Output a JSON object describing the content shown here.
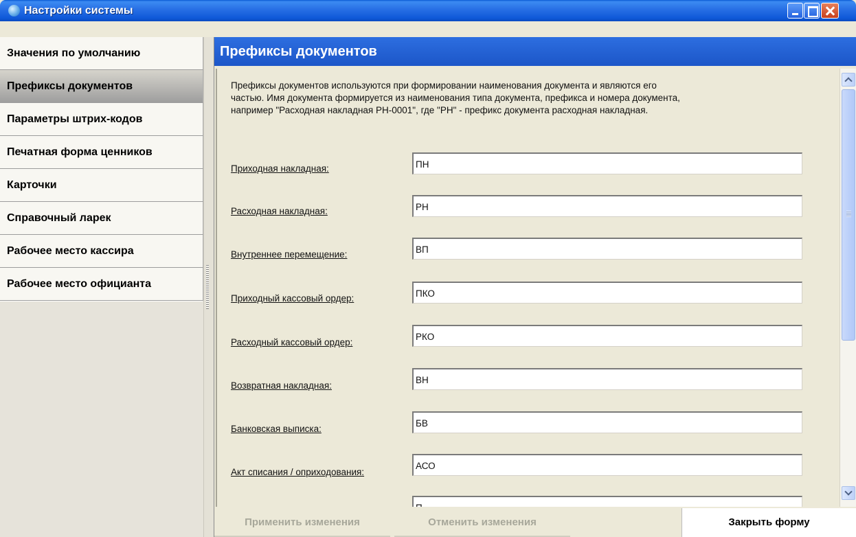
{
  "window": {
    "title": "Настройки системы"
  },
  "sidebar": {
    "items": [
      {
        "label": "Значения по умолчанию",
        "active": false
      },
      {
        "label": "Префиксы документов",
        "active": true
      },
      {
        "label": "Параметры штрих-кодов",
        "active": false
      },
      {
        "label": "Печатная форма ценников",
        "active": false
      },
      {
        "label": "Карточки",
        "active": false
      },
      {
        "label": "Справочный ларек",
        "active": false
      },
      {
        "label": "Рабочее место кассира",
        "active": false
      },
      {
        "label": "Рабочее место официанта",
        "active": false
      }
    ]
  },
  "content": {
    "title": "Префиксы документов",
    "description_lines": [
      "Префиксы документов используются при формировании наименования документа и являются его",
      "частью. Имя документа формируется из наименования типа документа, префикса и номера документа,",
      "например \"Расходная накладная РН-0001\", где \"РН\" - префикс документа расходная накладная."
    ],
    "fields": [
      {
        "label": "Приходная накладная:",
        "value": "ПН"
      },
      {
        "label": "Расходная накладная:",
        "value": "РН"
      },
      {
        "label": "Внутреннее перемещение:",
        "value": "ВП"
      },
      {
        "label": "Приходный кассовый ордер:",
        "value": "ПКО"
      },
      {
        "label": "Расходный кассовый ордер:",
        "value": "РКО"
      },
      {
        "label": "Возвратная накладная:",
        "value": "ВН"
      },
      {
        "label": "Банковская выписка:",
        "value": "БВ"
      },
      {
        "label": "Акт списания / оприходования:",
        "value": "АСО"
      },
      {
        "label": "",
        "value": "П"
      }
    ]
  },
  "footer": {
    "apply_label": "Применить изменения",
    "cancel_label": "Отменить изменения",
    "close_label": "Закрыть форму"
  },
  "icons": [
    "app-globe-icon",
    "minimize-icon",
    "maximize-icon",
    "close-icon",
    "scroll-up-icon",
    "scroll-down-icon"
  ],
  "colors": {
    "titlebar": "#2a72e6",
    "header": "#2160d2",
    "panel": "#ece9d8",
    "active_nav": "#a9a8a2"
  }
}
